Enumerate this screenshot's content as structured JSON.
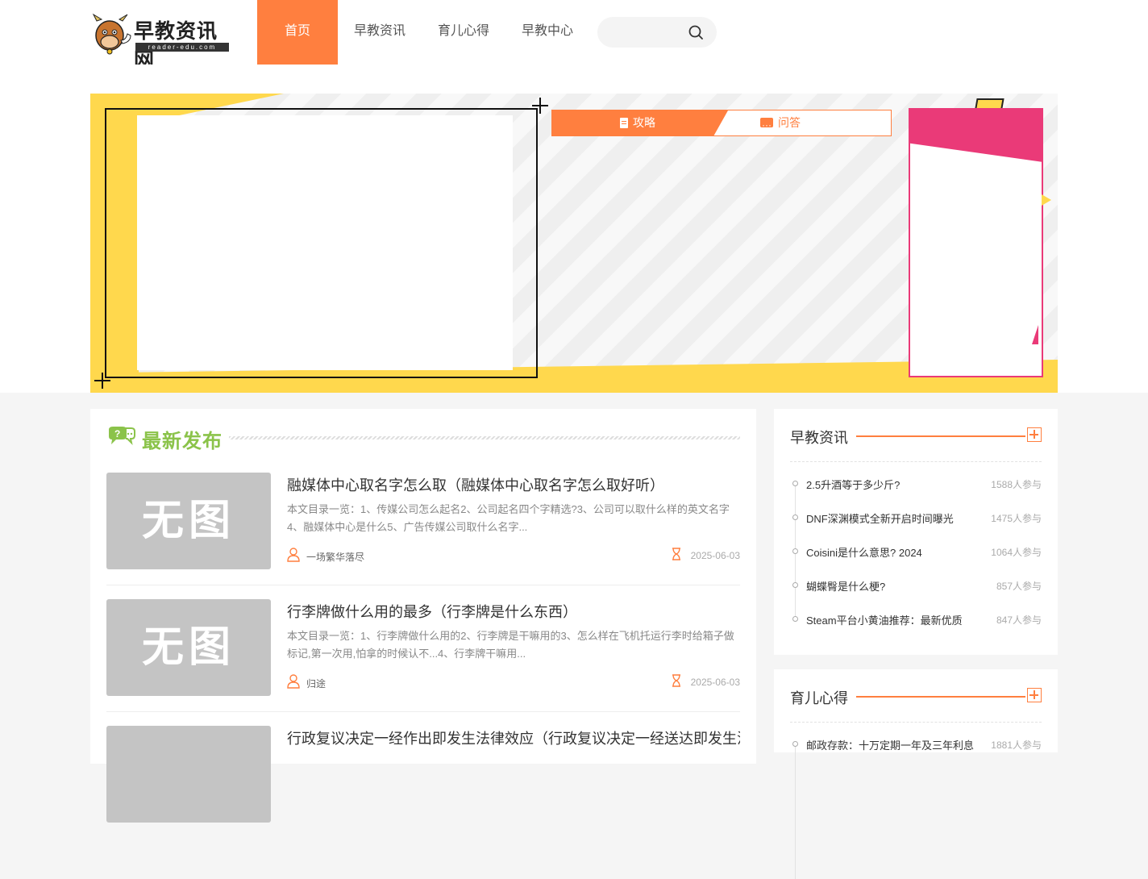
{
  "header": {
    "logo_title": "早教资讯网",
    "logo_subtitle": "reader-edu.com",
    "nav": [
      {
        "label": "首页",
        "active": true
      },
      {
        "label": "早教资讯",
        "active": false
      },
      {
        "label": "育儿心得",
        "active": false
      },
      {
        "label": "早教中心",
        "active": false
      }
    ],
    "search_placeholder": "",
    "accent_color": "#ff7f3f"
  },
  "banner": {
    "tab_active": "攻略",
    "tab_inactive": "问答"
  },
  "main": {
    "section_title": "最新发布",
    "articles": [
      {
        "thumb": "无图",
        "title": "融媒体中心取名字怎么取（融媒体中心取名字怎么取好听）",
        "desc": "本文目录一览：1、传媒公司怎么起名2、公司起名四个字精选?3、公司可以取什么样的英文名字4、融媒体中心是什么5、广告传媒公司取什么名字...",
        "author": "一场繁华落尽",
        "date": "2025-06-03"
      },
      {
        "thumb": "无图",
        "title": "行李牌做什么用的最多（行李牌是什么东西）",
        "desc": "本文目录一览：1、行李牌做什么用的2、行李牌是干嘛用的3、怎么样在飞机托运行李时给箱子做标记,第一次用,怕拿的时候认不...4、行李牌干嘛用...",
        "author": "归途",
        "date": "2025-06-03"
      },
      {
        "thumb": "",
        "title": "行政复议决定一经作出即发生法律效应（行政复议决定一经送达即发生法",
        "desc": "",
        "author": "",
        "date": ""
      }
    ]
  },
  "sidebar": {
    "sections": [
      {
        "title": "早教资讯",
        "items": [
          {
            "text": "2.5升酒等于多少斤?",
            "count": "1588人参与"
          },
          {
            "text": "DNF深渊模式全新开启时间曝光",
            "count": "1475人参与"
          },
          {
            "text": "Coisini是什么意思? 2024",
            "count": "1064人参与"
          },
          {
            "text": "蝴蝶臀是什么梗?",
            "count": "857人参与"
          },
          {
            "text": "Steam平台小黄油推荐：最新优质",
            "count": "847人参与"
          }
        ]
      },
      {
        "title": "育儿心得",
        "items": [
          {
            "text": "邮政存款：十万定期一年及三年利息",
            "count": "1881人参与"
          }
        ]
      }
    ]
  }
}
